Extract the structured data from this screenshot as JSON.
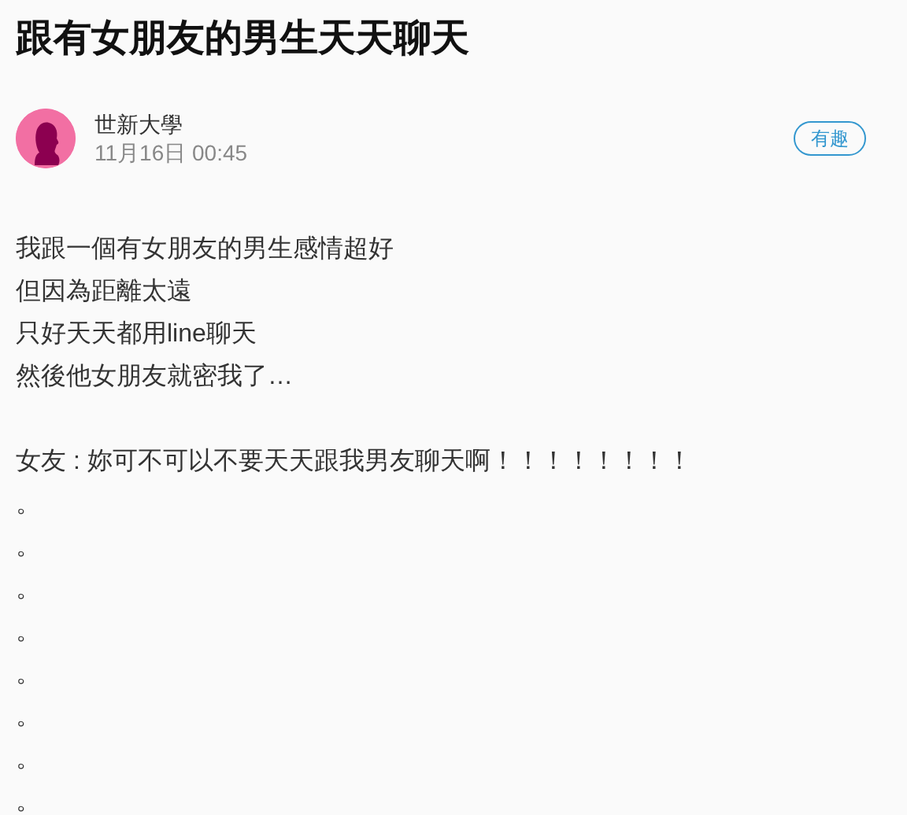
{
  "post": {
    "title": "跟有女朋友的男生天天聊天",
    "author": {
      "school": "世新大學",
      "time": "11月16日 00:45"
    },
    "tag": "有趣",
    "paragraphs": [
      [
        "我跟一個有女朋友的男生感情超好",
        "但因為距離太遠",
        "只好天天都用line聊天",
        "然後他女朋友就密我了…"
      ],
      [
        "女友 : 妳可不可以不要天天跟我男友聊天啊！！！！！！！！",
        "。",
        "。",
        "。",
        "。",
        "。",
        "。",
        "。",
        "。"
      ]
    ]
  }
}
